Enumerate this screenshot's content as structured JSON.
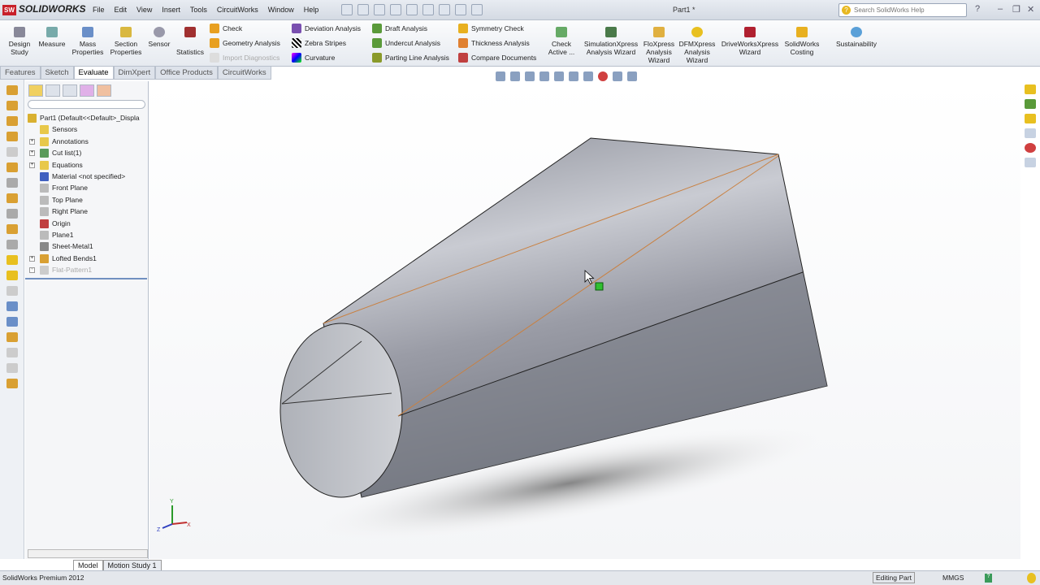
{
  "app": {
    "logo": "SOLIDWORKS",
    "document_title": "Part1 *",
    "search_placeholder": "Search SolidWorks Help"
  },
  "menu": [
    "File",
    "Edit",
    "View",
    "Insert",
    "Tools",
    "CircuitWorks",
    "Window",
    "Help"
  ],
  "ribbon": {
    "big": [
      {
        "label": "Design Study"
      },
      {
        "label": "Measure"
      },
      {
        "label": "Mass Properties"
      },
      {
        "label": "Section Properties"
      },
      {
        "label": "Sensor"
      },
      {
        "label": "Statistics"
      }
    ],
    "col1": [
      "Check",
      "Geometry Analysis",
      "Import Diagnostics"
    ],
    "col2": [
      "Deviation Analysis",
      "Zebra Stripes",
      "Curvature"
    ],
    "col3": [
      "Draft Analysis",
      "Undercut Analysis",
      "Parting Line Analysis"
    ],
    "col4": [
      "Symmetry Check",
      "Thickness Analysis",
      "Compare Documents"
    ],
    "big2": [
      {
        "label": "Check Active ..."
      },
      {
        "label": "SimulationXpress Analysis Wizard"
      },
      {
        "label": "FloXpress Analysis Wizard"
      },
      {
        "label": "DFMXpress Analysis Wizard"
      },
      {
        "label": "DriveWorksXpress Wizard"
      },
      {
        "label": "SolidWorks Costing"
      },
      {
        "label": "Sustainability"
      }
    ]
  },
  "tabs": [
    "Features",
    "Sketch",
    "Evaluate",
    "DimXpert",
    "Office Products",
    "CircuitWorks"
  ],
  "active_tab": "Evaluate",
  "tree": {
    "root": "Part1  (Default<<Default>_Displa",
    "items": [
      {
        "label": "Sensors",
        "expand": false,
        "color": "#e8c84a"
      },
      {
        "label": "Annotations",
        "expand": true,
        "color": "#e8c84a"
      },
      {
        "label": "Cut list(1)",
        "expand": true,
        "color": "#5a9a5a"
      },
      {
        "label": "Equations",
        "expand": true,
        "color": "#e8c84a"
      },
      {
        "label": "Material <not specified>",
        "expand": false,
        "color": "#4060c0"
      },
      {
        "label": "Front Plane",
        "expand": false,
        "color": "#bbbbbb"
      },
      {
        "label": "Top Plane",
        "expand": false,
        "color": "#bbbbbb"
      },
      {
        "label": "Right Plane",
        "expand": false,
        "color": "#bbbbbb"
      },
      {
        "label": "Origin",
        "expand": false,
        "color": "#c04040"
      },
      {
        "label": "Plane1",
        "expand": false,
        "color": "#bbbbbb"
      },
      {
        "label": "Sheet-Metal1",
        "expand": false,
        "color": "#888888"
      },
      {
        "label": "Lofted Bends1",
        "expand": true,
        "color": "#d9a033"
      },
      {
        "label": "Flat-Pattern1",
        "expand": true,
        "color": "#cccccc",
        "disabled": true
      }
    ]
  },
  "bottom_tabs": [
    "Model",
    "Motion Study 1"
  ],
  "status": {
    "product": "SolidWorks Premium 2012",
    "mode": "Editing Part",
    "units": "MMGS"
  },
  "triad": {
    "y": "Y",
    "x": "X",
    "z": "Z"
  }
}
